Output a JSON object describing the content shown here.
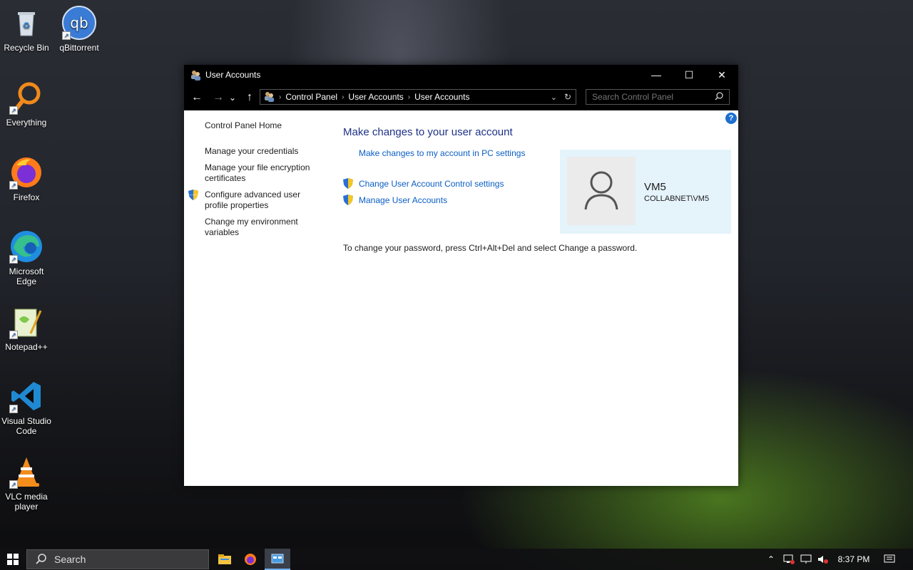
{
  "desktop": {
    "icons": [
      {
        "label": "Recycle Bin",
        "icon": "recycle-bin-icon"
      },
      {
        "label": "qBittorrent",
        "icon": "qbittorrent-icon"
      },
      {
        "label": "Everything",
        "icon": "everything-search-icon"
      },
      {
        "label": "Firefox",
        "icon": "firefox-icon"
      },
      {
        "label": "Microsoft Edge",
        "icon": "edge-icon"
      },
      {
        "label": "Notepad++",
        "icon": "notepadpp-icon"
      },
      {
        "label": "Visual Studio Code",
        "icon": "vscode-icon"
      },
      {
        "label": "VLC media player",
        "icon": "vlc-icon"
      }
    ]
  },
  "window": {
    "title": "User Accounts",
    "controls": {
      "minimize": "—",
      "maximize": "☐",
      "close": "✕"
    },
    "nav": {
      "back": "←",
      "forward": "→",
      "recent": "⌄",
      "up": "↑"
    },
    "breadcrumb": [
      "Control Panel",
      "User Accounts",
      "User Accounts"
    ],
    "search_placeholder": "Search Control Panel",
    "help": "?",
    "left_nav": [
      {
        "label": "Control Panel Home",
        "shield": false
      },
      {
        "label": "Manage your credentials",
        "shield": false
      },
      {
        "label": "Manage your file encryption certificates",
        "shield": false
      },
      {
        "label": "Configure advanced user profile properties",
        "shield": true
      },
      {
        "label": "Change my environment variables",
        "shield": false
      }
    ],
    "main": {
      "heading": "Make changes to your user account",
      "pc_settings_link": "Make changes to my account in PC settings",
      "uac_link": "Change User Account Control settings",
      "manage_link": "Manage User Accounts",
      "password_note": "To change your password, press Ctrl+Alt+Del and select Change a password."
    },
    "account": {
      "name": "VM5",
      "domain": "COLLABNET\\VM5"
    }
  },
  "taskbar": {
    "search_label": "Search",
    "time": "8:37 PM",
    "pinned": [
      "file-explorer-icon",
      "firefox-icon",
      "control-panel-icon"
    ]
  },
  "colors": {
    "link": "#0b5ec4",
    "heading": "#1e3287",
    "card": "#e5f3fb"
  }
}
